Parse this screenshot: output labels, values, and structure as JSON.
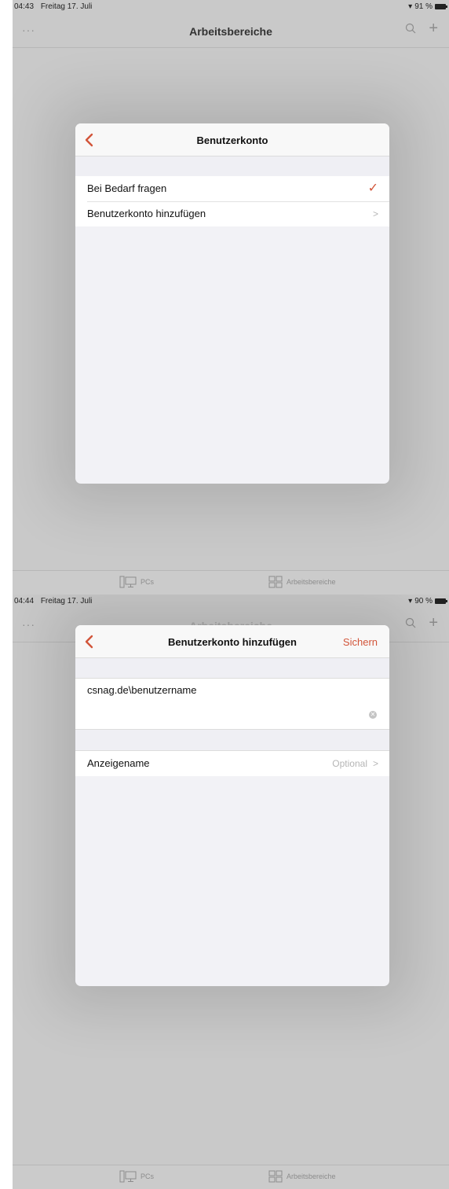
{
  "screens": [
    {
      "status": {
        "time": "04:43",
        "date": "Freitag 17. Juli",
        "battery": "91 %"
      },
      "nav": {
        "more": "···",
        "title": "Arbeitsbereiche",
        "plus": "+"
      },
      "sheet": {
        "title": "Benutzerkonto",
        "rows": [
          {
            "label": "Bei Bedarf fragen",
            "accessory": "✓"
          },
          {
            "label": "Benutzerkonto hinzufügen",
            "accessory": ">"
          }
        ]
      },
      "tabs": [
        {
          "label": "PCs"
        },
        {
          "label": "Arbeitsbereiche"
        }
      ]
    },
    {
      "status": {
        "time": "04:44",
        "date": "Freitag 17. Juli",
        "battery": "90 %"
      },
      "nav": {
        "more": "···",
        "title": "Arbeitsbereiche",
        "plus": "+"
      },
      "sheet": {
        "title": "Benutzerkonto hinzufügen",
        "save_label": "Sichern",
        "username_value": "csnag.de\\benutzername",
        "display_name_label": "Anzeigename",
        "display_name_placeholder": "Optional",
        "chevron": ">"
      },
      "tabs": [
        {
          "label": "PCs"
        },
        {
          "label": "Arbeitsbereiche"
        }
      ]
    }
  ],
  "colors": {
    "accent": "#d2553a",
    "background": "#c9c9c9",
    "sheet": "#f2f2f6"
  }
}
